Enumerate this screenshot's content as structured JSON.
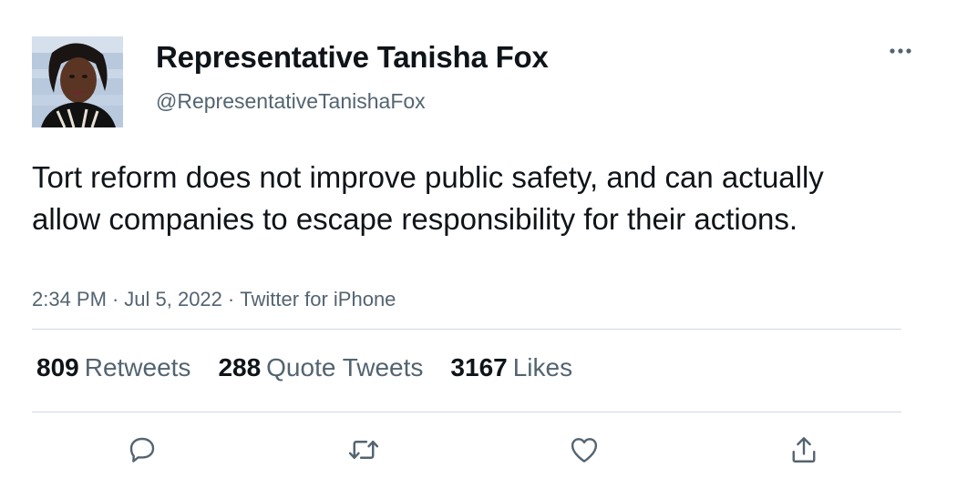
{
  "author": {
    "display_name": "Representative Tanisha Fox",
    "handle": "@RepresentativeTanishaFox"
  },
  "tweet": {
    "text": "Tort reform does not improve public safety, and can actually allow companies to escape responsibility for their actions.",
    "time": "2:34 PM",
    "date": "Jul 5, 2022",
    "source": "Twitter for iPhone",
    "separator": "·"
  },
  "stats": {
    "retweets": {
      "count": "809",
      "label": "Retweets"
    },
    "quote_tweets": {
      "count": "288",
      "label": "Quote Tweets"
    },
    "likes": {
      "count": "3167",
      "label": "Likes"
    }
  },
  "actions": [
    {
      "icon": "reply-icon"
    },
    {
      "icon": "retweet-icon"
    },
    {
      "icon": "like-icon"
    },
    {
      "icon": "share-icon"
    }
  ],
  "colors": {
    "text_primary": "#0f1419",
    "text_secondary": "#536471",
    "divider": "#cfd9de"
  }
}
